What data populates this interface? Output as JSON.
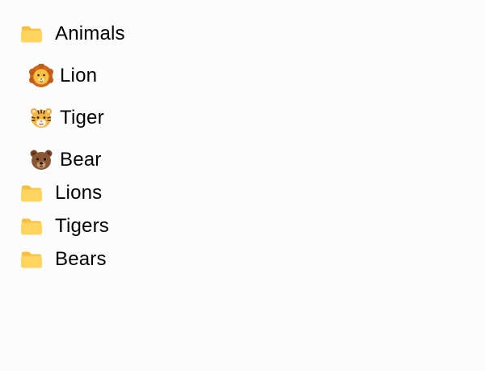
{
  "colors": {
    "background": "#fdfcfd",
    "folder_body": "#ffd560",
    "folder_tab": "#f7bf3c",
    "text": "#000000"
  },
  "tree": {
    "items": [
      {
        "label": "Animals",
        "icon": "folder-icon",
        "children": [
          {
            "label": "Lion",
            "icon": "lion-face-emoji"
          },
          {
            "label": "Tiger",
            "icon": "tiger-face-emoji"
          },
          {
            "label": "Bear",
            "icon": "bear-face-emoji"
          }
        ]
      },
      {
        "label": "Lions",
        "icon": "folder-icon"
      },
      {
        "label": "Tigers",
        "icon": "folder-icon"
      },
      {
        "label": "Bears",
        "icon": "folder-icon"
      }
    ]
  }
}
